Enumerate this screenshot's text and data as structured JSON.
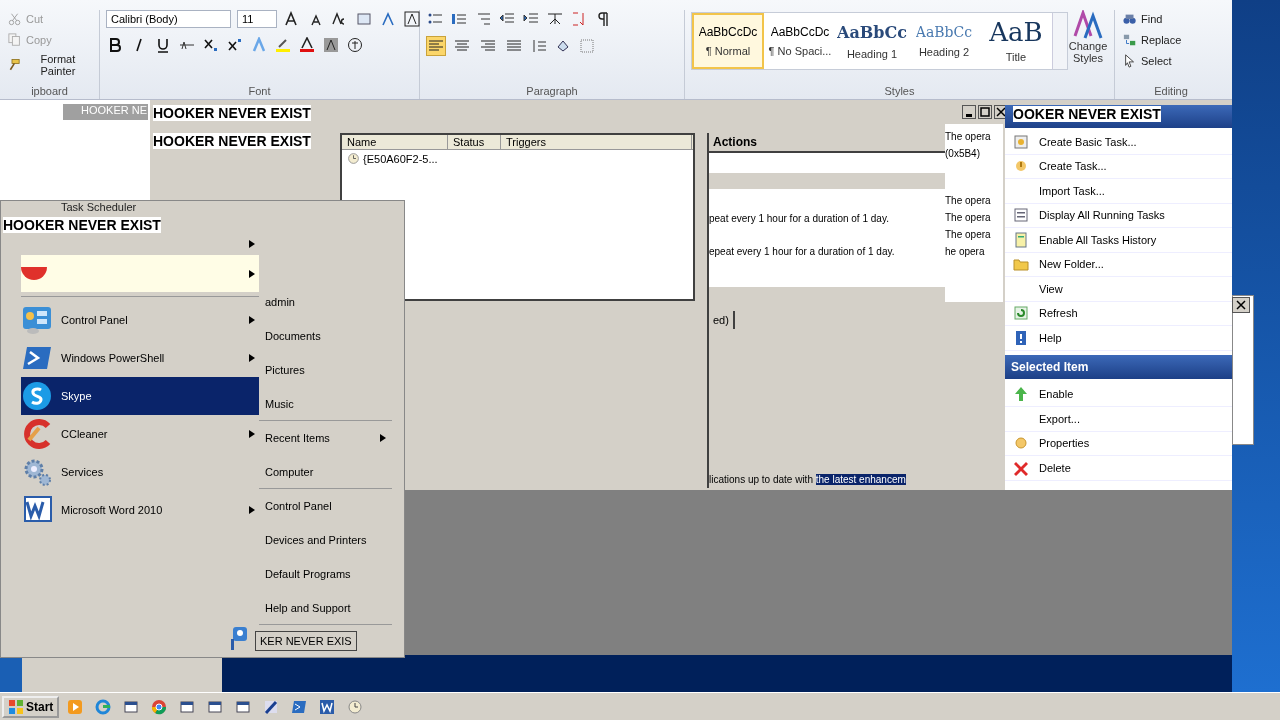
{
  "word_ribbon": {
    "clipboard": {
      "items": [
        {
          "label": "Cut",
          "kind": "cut",
          "disabled": true
        },
        {
          "label": "Copy",
          "kind": "copy",
          "disabled": true
        },
        {
          "label": "Format Painter",
          "kind": "painter",
          "disabled": false
        }
      ],
      "label": "ipboard"
    },
    "font": {
      "font_name": "Calibri (Body)",
      "font_size": "11",
      "label": "Font"
    },
    "paragraph": {
      "label": "Paragraph",
      "alignments": [
        {
          "kind": "left",
          "selected": true
        },
        {
          "kind": "center",
          "selected": false
        },
        {
          "kind": "right",
          "selected": false
        },
        {
          "kind": "justify",
          "selected": false
        }
      ]
    },
    "styles": {
      "label": "Styles",
      "items": [
        {
          "preview": "AaBbCcDc",
          "name": "¶ Normal",
          "kind": "normal",
          "selected": true
        },
        {
          "preview": "AaBbCcDc",
          "name": "¶ No Spaci...",
          "kind": "normal",
          "selected": false
        },
        {
          "preview": "AaBbCc",
          "name": "Heading 1",
          "kind": "heading1",
          "selected": false
        },
        {
          "preview": "AaBbCc",
          "name": "Heading 2",
          "kind": "heading2",
          "selected": false
        },
        {
          "preview": "AaB",
          "name": "Title",
          "kind": "title",
          "selected": false
        }
      ]
    },
    "change_styles": "Change Styles",
    "editing": {
      "label": "Editing",
      "items": [
        {
          "label": "Find",
          "kind": "find"
        },
        {
          "label": "Replace",
          "kind": "replace"
        },
        {
          "label": "Select",
          "kind": "select"
        }
      ]
    }
  },
  "background_tab": "HOOKER NE",
  "glitch_titles": [
    "HOOKER NEVER EXIST",
    "HOOKER NEVER EXIST"
  ],
  "task_list": {
    "columns": [
      "Name",
      "Status",
      "Triggers"
    ],
    "rows": [
      {
        "name": "{E50A60F2-5..."
      }
    ]
  },
  "task_details": {
    "header": "Actions",
    "lines": [
      "peat every 1 hour for a duration of 1 day.",
      "epeat every 1 hour for a duration of 1 day."
    ],
    "tab": "ed)",
    "description": "lications up to date with ",
    "selected_text": "the latest enhancem"
  },
  "history_column": [
    "The opera",
    "(0x5B4)",
    "The opera",
    "The opera",
    "The opera",
    "he opera"
  ],
  "actions_pane": {
    "title": "OOKER NEVER EXIST",
    "items": [
      {
        "label": "Create Basic Task...",
        "kind": "wizard"
      },
      {
        "label": "Create Task...",
        "kind": "task"
      },
      {
        "label": "Import Task...",
        "kind": "plain"
      },
      {
        "label": "Display All Running Tasks",
        "kind": "list"
      },
      {
        "label": "Enable All Tasks History",
        "kind": "notebook"
      },
      {
        "label": "New Folder...",
        "kind": "folder"
      },
      {
        "label": "View",
        "kind": "plain"
      },
      {
        "label": "Refresh",
        "kind": "refresh"
      },
      {
        "label": "Help",
        "kind": "help"
      }
    ],
    "section": {
      "title": "Selected Item",
      "items": [
        {
          "label": "Enable",
          "kind": "enable"
        },
        {
          "label": "Export...",
          "kind": "plain"
        },
        {
          "label": "Properties",
          "kind": "properties"
        },
        {
          "label": "Delete",
          "kind": "delete"
        }
      ]
    }
  },
  "start_menu": {
    "header": "HOOKER NEVER EXIST",
    "pinned_label": "Task Scheduler",
    "programs": [
      {
        "label": "Control Panel",
        "kind": "control-panel",
        "submenu": true,
        "selected": false
      },
      {
        "label": "Windows PowerShell",
        "kind": "shell",
        "submenu": true,
        "selected": false
      },
      {
        "label": "Skype",
        "kind": "chat",
        "submenu": false,
        "selected": true
      },
      {
        "label": "CCleaner",
        "kind": "cleaner",
        "submenu": true,
        "selected": false
      },
      {
        "label": "Services",
        "kind": "gears",
        "submenu": false,
        "selected": false
      },
      {
        "label": "Microsoft Word 2010",
        "kind": "document",
        "submenu": true,
        "selected": false
      }
    ],
    "places": [
      {
        "label": "admin",
        "submenu": false,
        "separator_after": false
      },
      {
        "label": "Documents",
        "submenu": false,
        "separator_after": false
      },
      {
        "label": "Pictures",
        "submenu": false,
        "separator_after": false
      },
      {
        "label": "Music",
        "submenu": false,
        "separator_after": true
      },
      {
        "label": "Recent Items",
        "submenu": true,
        "separator_after": false
      },
      {
        "label": "Computer",
        "submenu": false,
        "separator_after": true
      },
      {
        "label": "Control Panel",
        "submenu": false,
        "separator_after": false
      },
      {
        "label": "Devices and Printers",
        "submenu": false,
        "separator_after": false
      },
      {
        "label": "Default Programs",
        "submenu": false,
        "separator_after": false
      },
      {
        "label": "Help and Support",
        "submenu": false,
        "separator_after": true
      }
    ],
    "shutdown_label": "KER NEVER EXIS"
  },
  "taskbar": {
    "start": "Start",
    "apps": [
      {
        "kind": "media"
      },
      {
        "kind": "browser-ring"
      },
      {
        "kind": "window"
      },
      {
        "kind": "browser-round"
      },
      {
        "kind": "window"
      },
      {
        "kind": "window"
      },
      {
        "kind": "window"
      },
      {
        "kind": "pen"
      },
      {
        "kind": "shell"
      },
      {
        "kind": "document"
      },
      {
        "kind": "clock"
      }
    ]
  }
}
